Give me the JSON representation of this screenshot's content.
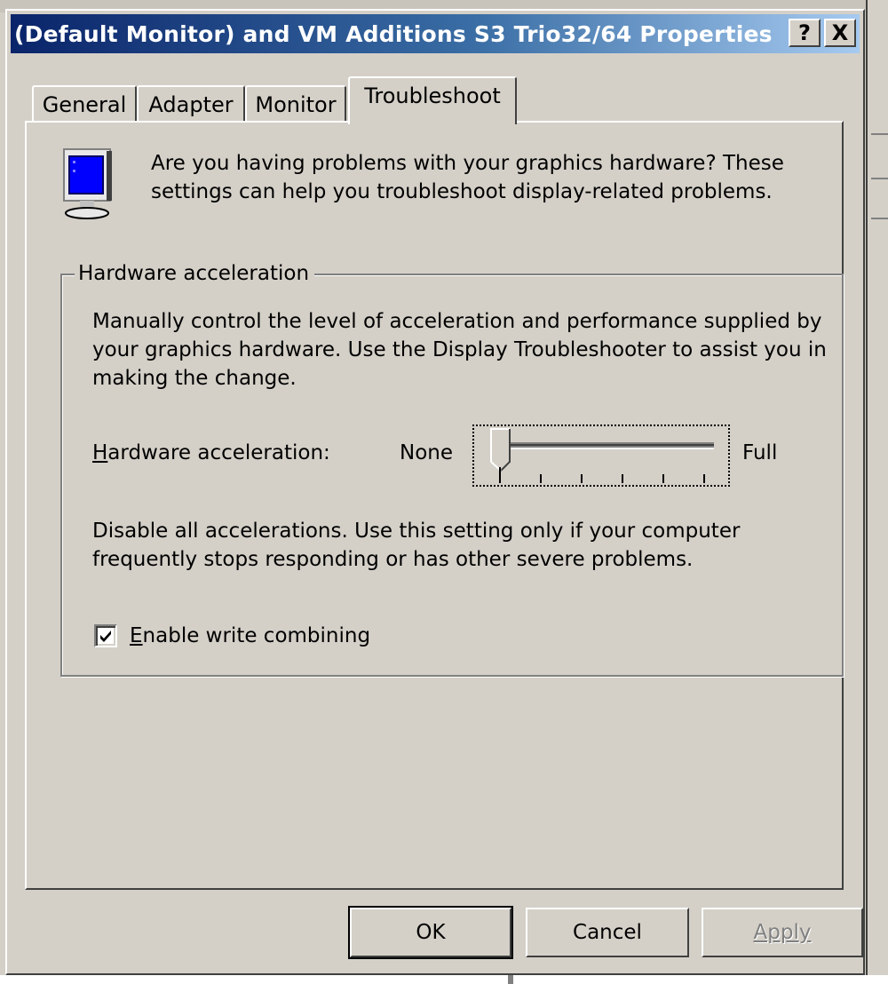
{
  "window": {
    "title": "(Default Monitor) and VM Additions S3 Trio32/64 Properties",
    "help_button": "?",
    "close_button": "X"
  },
  "tabs": [
    {
      "label": "General",
      "active": false
    },
    {
      "label": "Adapter",
      "active": false
    },
    {
      "label": "Monitor",
      "active": false
    },
    {
      "label": "Troubleshoot",
      "active": true
    }
  ],
  "troubleshoot": {
    "icon": "monitor-icon",
    "intro": "Are you having problems with your graphics hardware? These settings can help you troubleshoot display-related problems.",
    "group": {
      "title": "Hardware acceleration",
      "description": "Manually control the level of acceleration and performance supplied by your graphics hardware. Use the Display Troubleshooter to assist you in making the change.",
      "slider": {
        "label_prefix_underlined": "H",
        "label_rest": "ardware acceleration:",
        "min_label": "None",
        "max_label": "Full",
        "tick_count": 6,
        "value": 0,
        "max": 5
      },
      "setting_note": "Disable all accelerations. Use this setting only if your computer frequently stops responding or has other severe problems.",
      "checkbox": {
        "label_prefix_underlined": "E",
        "label_rest": "nable write combining",
        "checked": true
      }
    }
  },
  "buttons": {
    "ok": "OK",
    "cancel": "Cancel",
    "apply": "Apply",
    "apply_enabled": false
  },
  "colors": {
    "titlebar_start": "#0a246a",
    "titlebar_end": "#a6caf0",
    "face": "#d4d0c8",
    "screen_blue": "#0000ff"
  }
}
